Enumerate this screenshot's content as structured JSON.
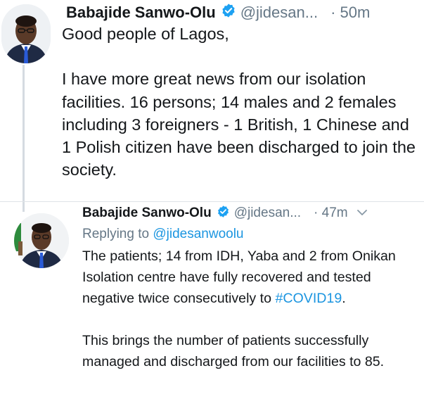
{
  "tweets": [
    {
      "author_name": "Babajide Sanwo-Olu",
      "handle": "@jidesan...",
      "time": "· 50m",
      "text": "Good people of Lagos,\n\nI have more great news from our isolation facilities. 16 persons; 14 males and 2 females including 3 foreigners - 1 British, 1 Chinese and 1 Polish citizen have been discharged to join the society."
    },
    {
      "author_name": "Babajide Sanwo-Olu",
      "handle": "@jidesan...",
      "time": "· 47m",
      "replying_prefix": "Replying to ",
      "replying_to": "@jidesanwoolu",
      "text_part1": "The patients; 14 from IDH, Yaba and 2 from Onikan Isolation centre have fully recovered and tested negative twice consecutively to ",
      "hashtag": "#COVID19",
      "text_part2": ".\n\nThis brings the number of patients successfully managed and discharged from our facilities to 85."
    }
  ],
  "colors": {
    "verified": "#1da1f2",
    "link": "#1b95e0",
    "muted": "#657786"
  },
  "icons": [
    "verified-badge-icon",
    "chevron-down-icon"
  ]
}
